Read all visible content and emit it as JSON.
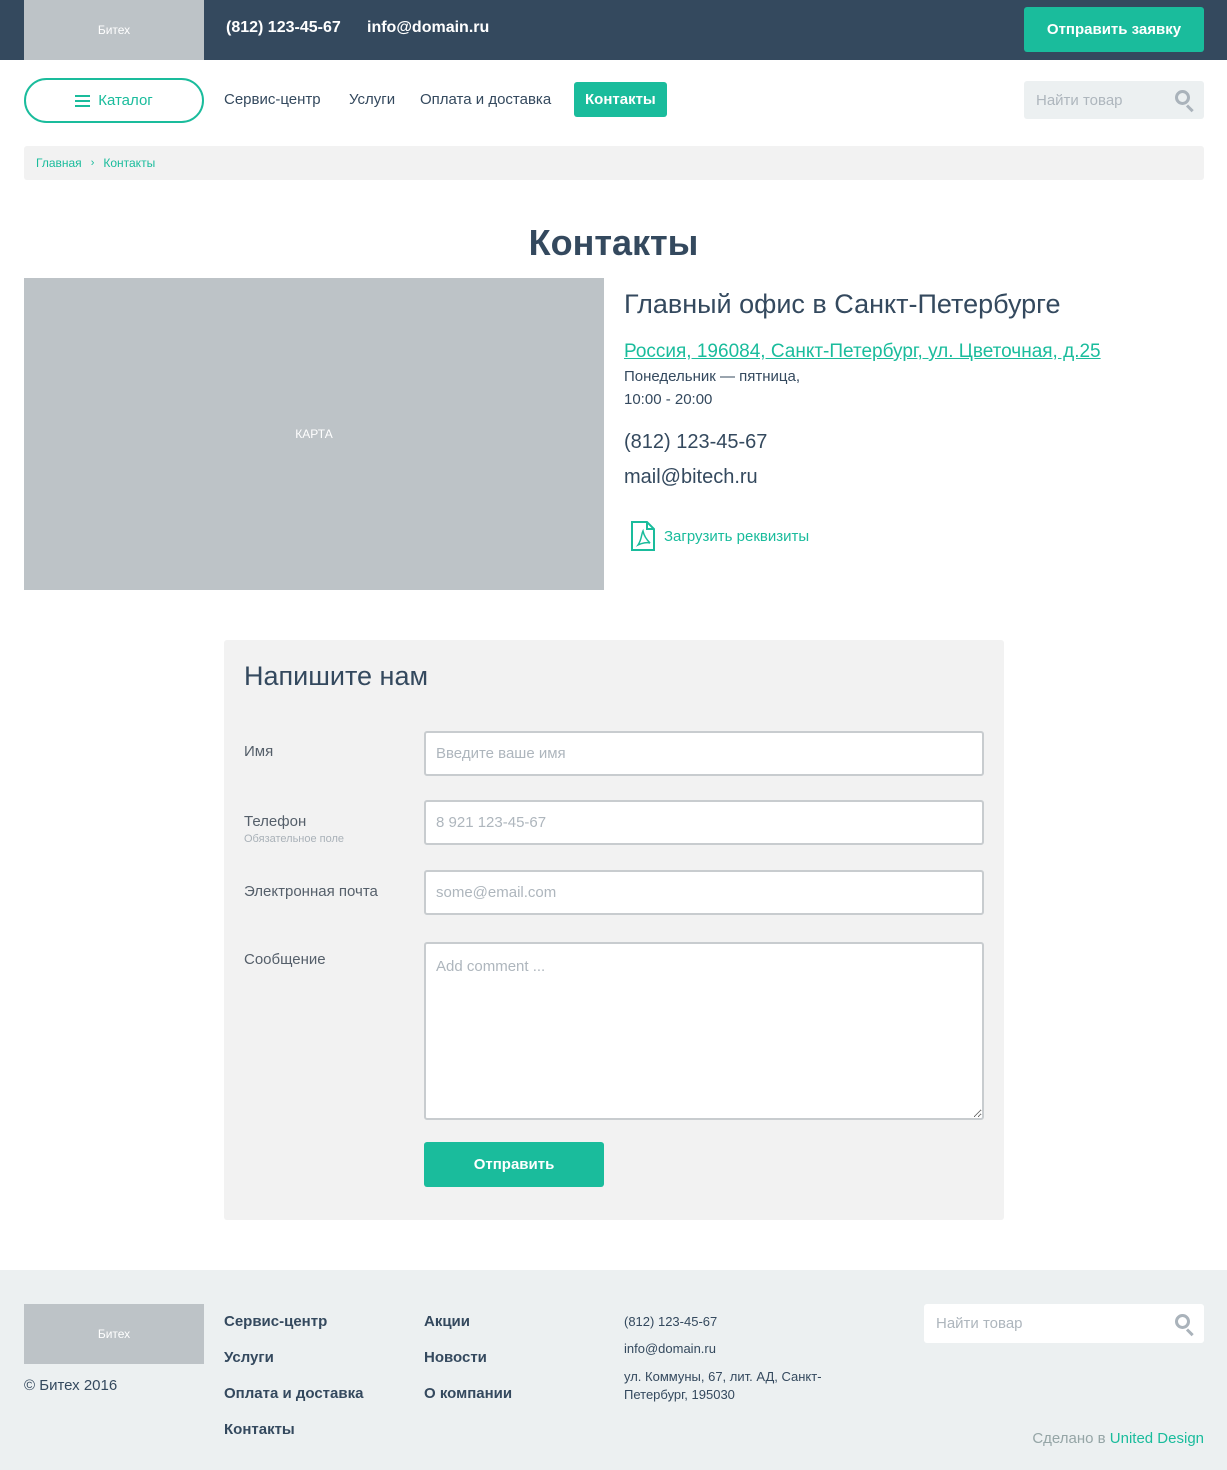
{
  "header": {
    "logo_text": "Битех",
    "phone": "(812) 123-45-67",
    "email": "info@domain.ru",
    "request_button": "Отправить заявку"
  },
  "nav": {
    "catalog_label": "Каталог",
    "items": [
      "Сервис-центр",
      "Услуги",
      "Оплата и доставка"
    ],
    "active_item": "Контакты",
    "search_placeholder": "Найти товар"
  },
  "breadcrumb": {
    "home": "Главная",
    "separator": "›",
    "current": "Контакты"
  },
  "page_title": "Контакты",
  "map_label": "КАРТА",
  "office": {
    "title": "Главный офис в Санкт-Петербурге",
    "address": "Россия, 196084, Санкт-Петербург, ул. Цветочная, д.25",
    "days": "Понедельник — пятница,",
    "hours": "10:00 - 20:00",
    "phone": "(812) 123-45-67",
    "email": "mail@bitech.ru",
    "download_label": "Загрузить реквизиты"
  },
  "form": {
    "title": "Напишите нам",
    "name_label": "Имя",
    "name_placeholder": "Введите ваше имя",
    "phone_label": "Телефон",
    "phone_hint": "Обязательное поле",
    "phone_placeholder": "8 921 123-45-67",
    "email_label": "Электронная почта",
    "email_placeholder": "some@email.com",
    "message_label": "Сообщение",
    "message_placeholder": "Add comment ...",
    "submit_label": "Отправить"
  },
  "footer": {
    "logo_text": "Битех",
    "copyright": "© Битех 2016",
    "col1": [
      "Сервис-центр",
      "Услуги",
      "Оплата и доставка",
      "Контакты"
    ],
    "col2": [
      "Акции",
      "Новости",
      "О компании"
    ],
    "phone": "(812) 123-45-67",
    "email": "info@domain.ru",
    "address": "ул. Коммуны, 67, лит. АД, Санкт-Петербург, 195030",
    "search_placeholder": "Найти товар",
    "made_by_prefix": "Сделано в",
    "made_by_link": "United Design"
  },
  "colors": {
    "accent": "#1abc9c",
    "dark": "#34495e",
    "placeholder_gray": "#bdc3c7"
  }
}
